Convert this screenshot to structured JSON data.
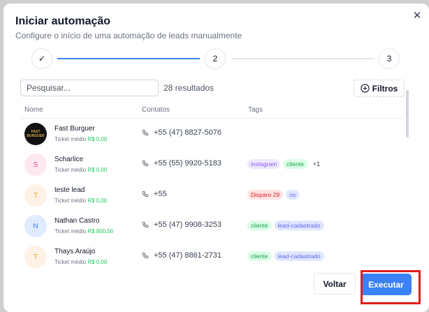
{
  "dialog": {
    "title": "Iniciar automação",
    "subtitle": "Configure o início de uma automação de leads manualmente",
    "close_icon": "x-icon"
  },
  "stepper": {
    "steps": [
      {
        "label": "✓",
        "icon": "check-icon",
        "state": "done"
      },
      {
        "label": "2",
        "state": "current"
      },
      {
        "label": "3",
        "state": "upcoming"
      }
    ]
  },
  "search": {
    "placeholder": "Pesquisar...",
    "value": ""
  },
  "results_count": "28 resultados",
  "filters_label": "Filtros",
  "table": {
    "columns": [
      "Nome",
      "Contatos",
      "Tags"
    ],
    "ticket_label": "Ticket médio",
    "rows": [
      {
        "name": "Fast Burguer",
        "avatar_text": [
          "FAST",
          "BURGUER"
        ],
        "ticket_value": "R$ 0,00",
        "phone": "+55 (47) 8827-5076",
        "tags": []
      },
      {
        "name": "Scharlice",
        "avatar_text": "S",
        "ticket_value": "R$ 0,00",
        "phone": "+55 (55) 9920-5183",
        "tags": [
          {
            "label": "instagram",
            "color": "purple"
          },
          {
            "label": "cliente",
            "color": "green"
          }
        ],
        "more": "+1"
      },
      {
        "name": "teste lead",
        "avatar_text": "T",
        "ticket_value": "R$ 0,00",
        "phone": "+55",
        "tags": [
          {
            "label": "Disparo 29",
            "color": "red"
          },
          {
            "label": "os",
            "color": "indigo"
          }
        ]
      },
      {
        "name": "Nathan Castro",
        "avatar_text": "N",
        "ticket_value": "R$ 800,00",
        "phone": "+55 (47) 9908-3253",
        "tags": [
          {
            "label": "cliente",
            "color": "green"
          },
          {
            "label": "lead-cadastrado",
            "color": "indigo"
          }
        ]
      },
      {
        "name": "Thays Araújo",
        "avatar_text": "T",
        "ticket_value": "R$ 0,00",
        "phone": "+55 (47) 8861-2731",
        "tags": [
          {
            "label": "cliente",
            "color": "green"
          },
          {
            "label": "lead-cadastrado",
            "color": "indigo"
          }
        ]
      }
    ]
  },
  "footer": {
    "back_label": "Voltar",
    "execute_label": "Executar"
  },
  "colors": {
    "accent": "#3b82f6",
    "highlight": "#e11d1d",
    "ticket_value": "#22c55e"
  }
}
